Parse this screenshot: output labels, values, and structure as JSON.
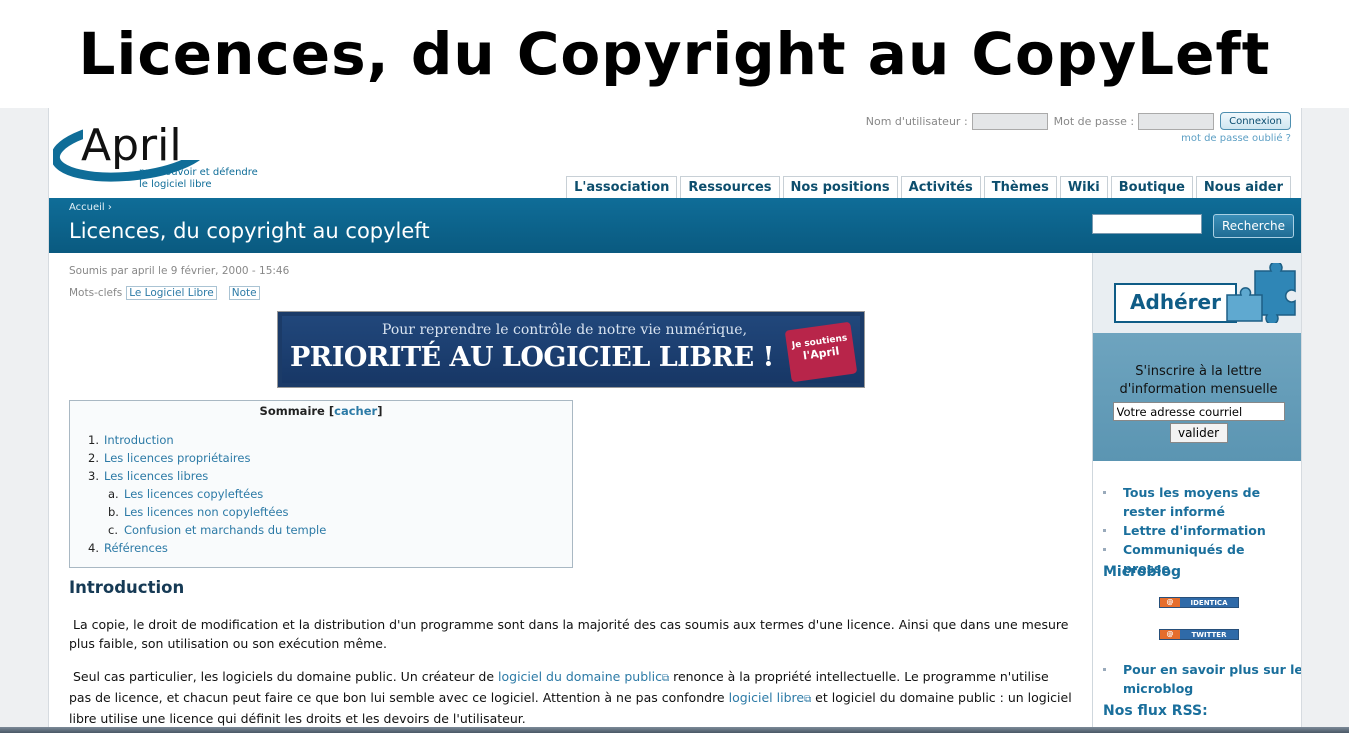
{
  "slide_title": "Licences, du Copyright au CopyLeft",
  "logo": {
    "name": "April",
    "tagline_1": "promouvoir et défendre",
    "tagline_2": "le logiciel libre"
  },
  "login": {
    "user_label": "Nom d'utilisateur :",
    "pass_label": "Mot de passe :",
    "button": "Connexion",
    "forgot": "mot de passe oublié ?"
  },
  "nav": [
    "L'association",
    "Ressources",
    "Nos positions",
    "Activités",
    "Thèmes",
    "Wiki",
    "Boutique",
    "Nous aider"
  ],
  "breadcrumb": "Accueil ›",
  "page_title": "Licences, du copyright au copyleft",
  "search": {
    "button": "Recherche"
  },
  "meta": "Soumis par april le 9 février, 2000 - 15:46",
  "tags": {
    "label": "Mots-clefs",
    "items": [
      "Le Logiciel Libre",
      "Note"
    ]
  },
  "banner": {
    "top": "Pour reprendre le contrôle de notre vie numérique,",
    "main": "PRIORITÉ AU LOGICIEL LIBRE !",
    "badge_1": "Je soutiens",
    "badge_2": "l'April"
  },
  "toc": {
    "title": "Sommaire",
    "hide_open": "[",
    "hide": "cacher",
    "hide_close": "]",
    "items": [
      {
        "n": "1.",
        "label": "Introduction"
      },
      {
        "n": "2.",
        "label": "Les licences propriétaires"
      },
      {
        "n": "3.",
        "label": "Les licences libres"
      },
      {
        "n": "a.",
        "label": "Les licences copyleftées"
      },
      {
        "n": "b.",
        "label": "Les licences non copyleftées"
      },
      {
        "n": "c.",
        "label": "Confusion et marchands du temple"
      },
      {
        "n": "4.",
        "label": "Références"
      }
    ]
  },
  "intro": {
    "heading": "Introduction",
    "p1": "La copie, le droit de modification et la distribution d'un programme sont dans la majorité des cas soumis aux termes d'une licence. Ainsi que dans une mesure plus faible, son utilisation ou son exécution même.",
    "p2_a": "Seul cas particulier, les logiciels du domaine public. Un créateur de ",
    "p2_link1": "logiciel du domaine public",
    "p2_b": " renonce à la propriété intellectuelle. Le programme n'utilise pas de licence, et chacun peut faire ce que bon lui semble avec ce logiciel. Attention à ne pas confondre ",
    "p2_link2": "logiciel libre",
    "p2_c": " et logiciel du domaine public : un logiciel libre utilise une licence qui définit les droits et les devoirs de l'utilisateur."
  },
  "sidebar": {
    "adherer": "Adhérer",
    "newsletter_title": "S'inscrire à la lettre d'information mensuelle",
    "newsletter_value": "Votre adresse courriel",
    "newsletter_button": "valider",
    "links": [
      "Tous les moyens de rester informé",
      "Lettre d'information",
      "Communiqués de presse"
    ],
    "microblog": "Microblog",
    "identica": "IDENTICA",
    "twitter": "TWITTER",
    "badge_at": "@",
    "more": "Pour en savoir plus sur le microblog",
    "rss": "Nos flux RSS:"
  },
  "colors": {
    "brand": "#0f6d98",
    "link": "#2c7aa6",
    "banner": "#1b3b68",
    "badge": "#b8254a"
  }
}
